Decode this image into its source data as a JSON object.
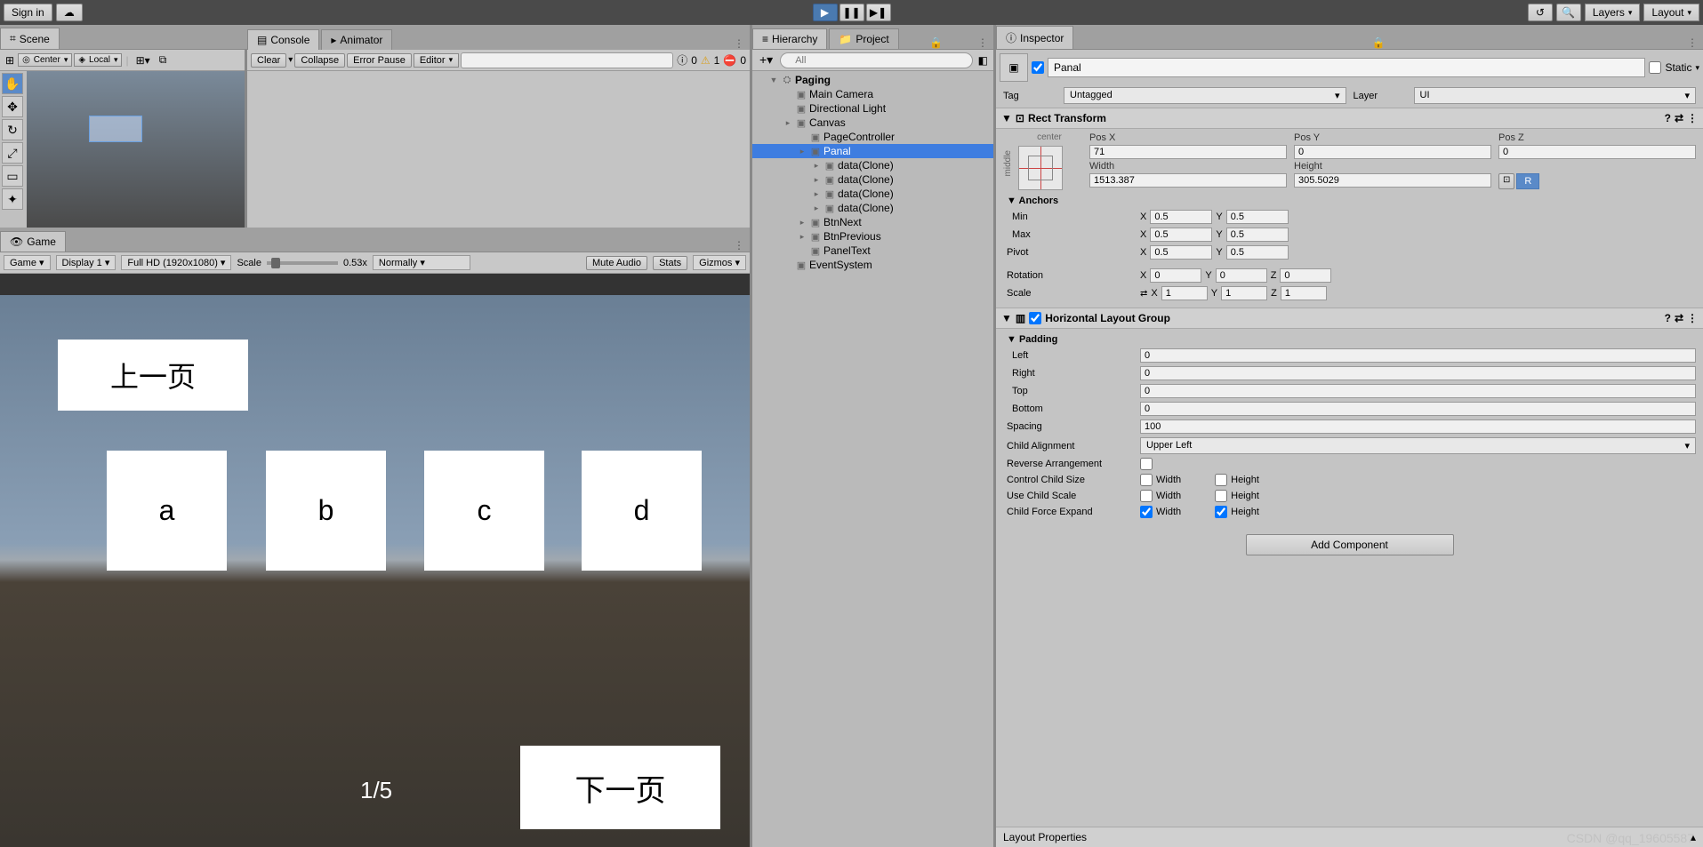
{
  "topbar": {
    "signin": "Sign in",
    "layers": "Layers",
    "layout": "Layout"
  },
  "tabs": {
    "scene": "Scene",
    "console": "Console",
    "animator": "Animator",
    "game": "Game",
    "hierarchy": "Hierarchy",
    "project": "Project",
    "inspector": "Inspector"
  },
  "scene_tb": {
    "center": "Center",
    "local": "Local"
  },
  "console_tb": {
    "clear": "Clear",
    "collapse": "Collapse",
    "error_pause": "Error Pause",
    "editor": "Editor",
    "info_count": "0",
    "warn_count": "1",
    "err_count": "0"
  },
  "game_tb": {
    "game": "Game",
    "display": "Display 1",
    "res": "Full HD (1920x1080)",
    "scale_label": "Scale",
    "scale_val": "0.53x",
    "normally": "Normally",
    "mute": "Mute Audio",
    "stats": "Stats",
    "gizmos": "Gizmos"
  },
  "game_content": {
    "prev_btn": "上一页",
    "next_btn": "下一页",
    "cards": [
      "a",
      "b",
      "c",
      "d"
    ],
    "page_text": "1/5"
  },
  "hierarchy": {
    "search_placeholder": "All",
    "scene_name": "Paging",
    "items": [
      {
        "name": "Main Camera",
        "indent": 2
      },
      {
        "name": "Directional Light",
        "indent": 2
      },
      {
        "name": "Canvas",
        "indent": 2,
        "arrow": true
      },
      {
        "name": "PageController",
        "indent": 3
      },
      {
        "name": "Panal",
        "indent": 3,
        "arrow": true,
        "selected": true
      },
      {
        "name": "data(Clone)",
        "indent": 4,
        "arrow": true
      },
      {
        "name": "data(Clone)",
        "indent": 4,
        "arrow": true
      },
      {
        "name": "data(Clone)",
        "indent": 4,
        "arrow": true
      },
      {
        "name": "data(Clone)",
        "indent": 4,
        "arrow": true
      },
      {
        "name": "BtnNext",
        "indent": 3,
        "arrow": true
      },
      {
        "name": "BtnPrevious",
        "indent": 3,
        "arrow": true
      },
      {
        "name": "PanelText",
        "indent": 3
      },
      {
        "name": "EventSystem",
        "indent": 2
      }
    ]
  },
  "inspector": {
    "name": "Panal",
    "static_label": "Static",
    "tag_label": "Tag",
    "tag_value": "Untagged",
    "layer_label": "Layer",
    "layer_value": "UI",
    "rect_transform": {
      "title": "Rect Transform",
      "anchor_h": "center",
      "anchor_v": "middle",
      "posx_lbl": "Pos X",
      "posx": "71",
      "posy_lbl": "Pos Y",
      "posy": "0",
      "posz_lbl": "Pos Z",
      "posz": "0",
      "width_lbl": "Width",
      "width": "1513.387",
      "height_lbl": "Height",
      "height": "305.5029",
      "anchors_lbl": "Anchors",
      "min_lbl": "Min",
      "min_x": "0.5",
      "min_y": "0.5",
      "max_lbl": "Max",
      "max_x": "0.5",
      "max_y": "0.5",
      "pivot_lbl": "Pivot",
      "pivot_x": "0.5",
      "pivot_y": "0.5",
      "rotation_lbl": "Rotation",
      "rot_x": "0",
      "rot_y": "0",
      "rot_z": "0",
      "scale_lbl": "Scale",
      "scale_x": "1",
      "scale_y": "1",
      "scale_z": "1",
      "r_btn": "R"
    },
    "hlg": {
      "title": "Horizontal Layout Group",
      "padding_lbl": "Padding",
      "left_lbl": "Left",
      "left": "0",
      "right_lbl": "Right",
      "right": "0",
      "top_lbl": "Top",
      "top": "0",
      "bottom_lbl": "Bottom",
      "bottom": "0",
      "spacing_lbl": "Spacing",
      "spacing": "100",
      "child_align_lbl": "Child Alignment",
      "child_align": "Upper Left",
      "reverse_lbl": "Reverse Arrangement",
      "ctrl_size_lbl": "Control Child Size",
      "use_scale_lbl": "Use Child Scale",
      "force_expand_lbl": "Child Force Expand",
      "width_lbl": "Width",
      "height_lbl": "Height"
    },
    "add_component": "Add Component",
    "layout_properties": "Layout Properties"
  },
  "watermark": "CSDN @qq_19605587"
}
